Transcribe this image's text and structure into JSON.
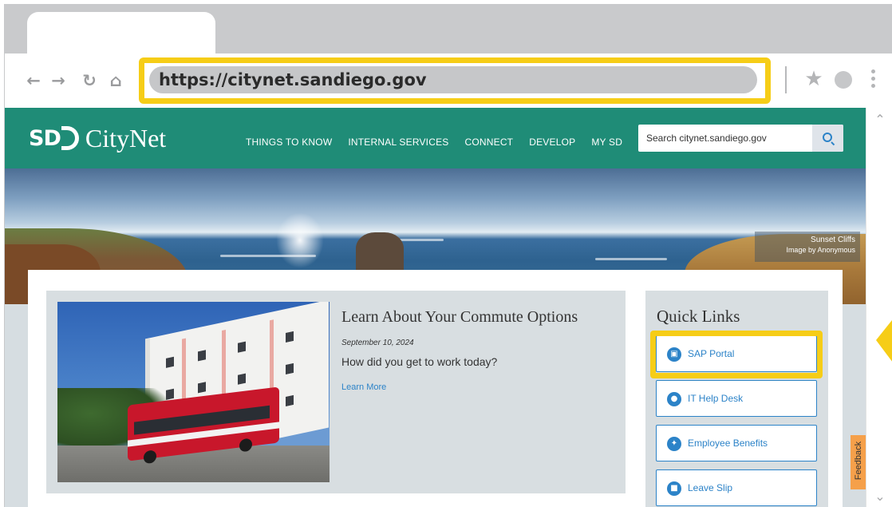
{
  "browser": {
    "url": "https://citynet.sandiego.gov",
    "nav_icons": [
      "back-arrow-icon",
      "forward-arrow-icon",
      "reload-icon",
      "home-icon"
    ],
    "toolbar_icons": [
      "star-icon",
      "profile-icon",
      "menu-dots-icon"
    ],
    "highlight_color": "#f6cd17"
  },
  "site": {
    "logo_mark": "SD",
    "logo_name": "CityNet",
    "brand_color": "#1f8c77",
    "nav": [
      "THINGS TO KNOW",
      "INTERNAL SERVICES",
      "CONNECT",
      "DEVELOP",
      "MY SD"
    ],
    "search_placeholder": "Search citynet.sandiego.gov"
  },
  "hero": {
    "credit_title": "Sunset Cliffs",
    "credit_by": "Image by Anonymous"
  },
  "feature": {
    "title": "Learn About Your Commute Options",
    "date": "September 10, 2024",
    "body": "How did you get to work today?",
    "link": "Learn More"
  },
  "quick_links": {
    "title": "Quick Links",
    "items": [
      {
        "label": "SAP Portal",
        "icon": "monitor-icon"
      },
      {
        "label": "IT Help Desk",
        "icon": "chat-bubble-icon"
      },
      {
        "label": "Employee Benefits",
        "icon": "benefits-icon"
      },
      {
        "label": "Leave Slip",
        "icon": "document-icon"
      }
    ],
    "accent": "#2c83c8"
  },
  "feedback": {
    "label": "Feedback",
    "color": "#f5a04a"
  }
}
